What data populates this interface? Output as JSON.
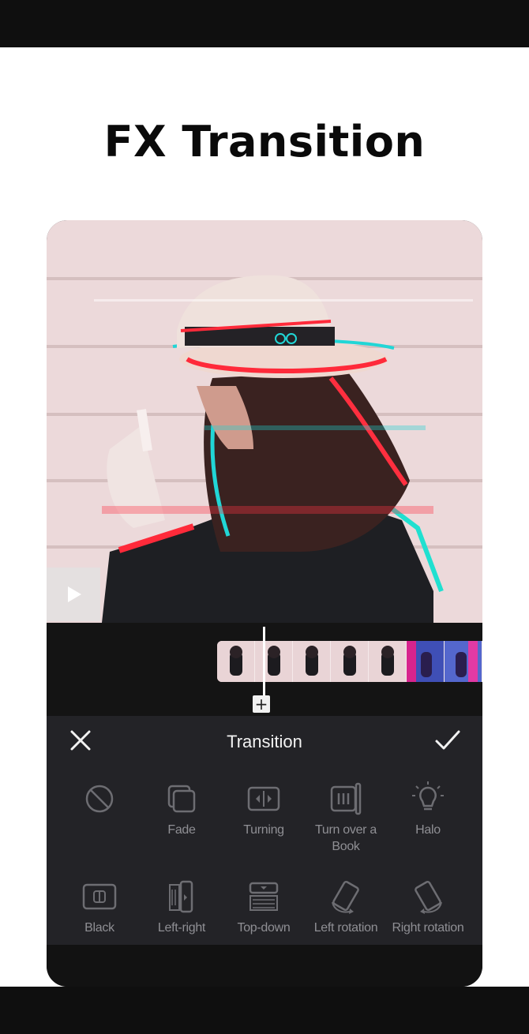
{
  "headline": "FX Transition",
  "panel": {
    "title": "Transition",
    "items": [
      {
        "label": "",
        "icon": "none-icon"
      },
      {
        "label": "Fade",
        "icon": "fade-icon"
      },
      {
        "label": "Turning",
        "icon": "turning-icon"
      },
      {
        "label": "Turn over a Book",
        "icon": "book-icon"
      },
      {
        "label": "Halo",
        "icon": "halo-icon"
      },
      {
        "label": "Black",
        "icon": "black-icon"
      },
      {
        "label": "Left-right",
        "icon": "left-right-icon"
      },
      {
        "label": "Top-down",
        "icon": "top-down-icon"
      },
      {
        "label": "Left rotation",
        "icon": "left-rotation-icon"
      },
      {
        "label": "Right rotation",
        "icon": "right-rotation-icon"
      }
    ]
  },
  "timeline": {
    "add_symbol": "+"
  },
  "colors": {
    "panel_bg": "#232327",
    "preview_bg": "#ecd9da",
    "label_gray": "#8f8f94"
  }
}
